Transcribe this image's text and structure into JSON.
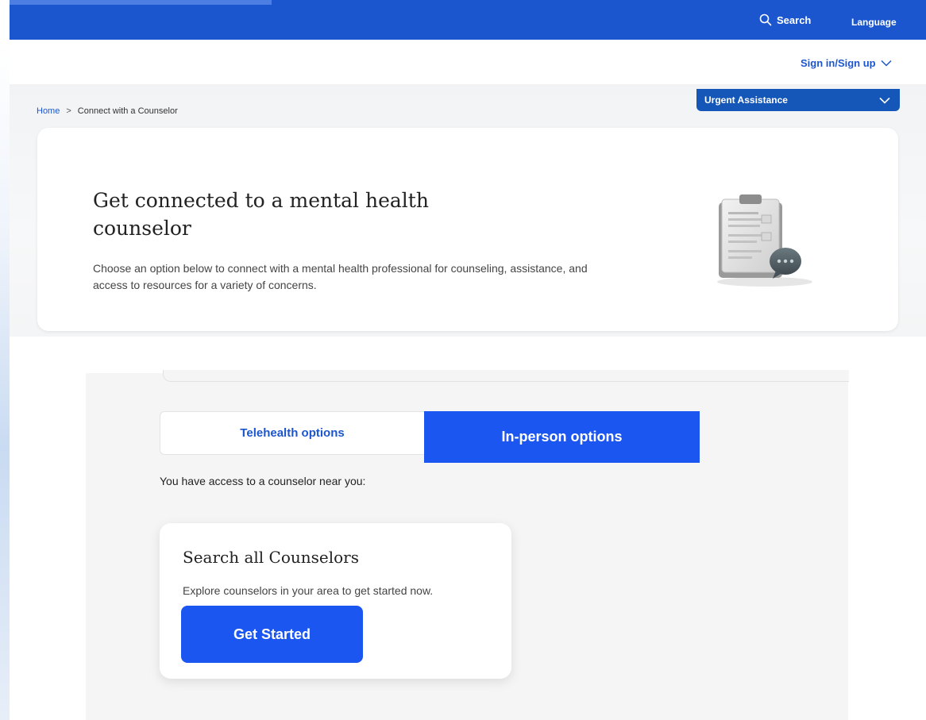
{
  "topbar": {
    "search_label": "Search",
    "language_label": "Language"
  },
  "account": {
    "signin_label": "Sign in/Sign up"
  },
  "breadcrumb": {
    "home": "Home",
    "separator": ">",
    "current": "Connect with a Counselor"
  },
  "urgent": {
    "label": "Urgent Assistance"
  },
  "hero": {
    "title": "Get connected to a mental health counselor",
    "description": "Choose an option below to connect with a mental health professional for counseling, assistance, and access to resources for a variety of concerns."
  },
  "tabs": [
    {
      "label": "Telehealth options",
      "active": false
    },
    {
      "label": "In-person options",
      "active": true
    }
  ],
  "access_text": "You have access to a counselor near you:",
  "search_card": {
    "title": "Search all Counselors",
    "description": "Explore counselors in your area to get started now.",
    "button_label": "Get Started"
  },
  "colors": {
    "brand_blue": "#1c56cf",
    "button_blue": "#1c56f0",
    "urgent_blue": "#1557b8"
  },
  "icons": {
    "search": "search-icon",
    "signin_chevron": "chevron-down-icon",
    "urgent_chevron": "chevron-down-icon",
    "hero": "clipboard-chat-illustration"
  }
}
